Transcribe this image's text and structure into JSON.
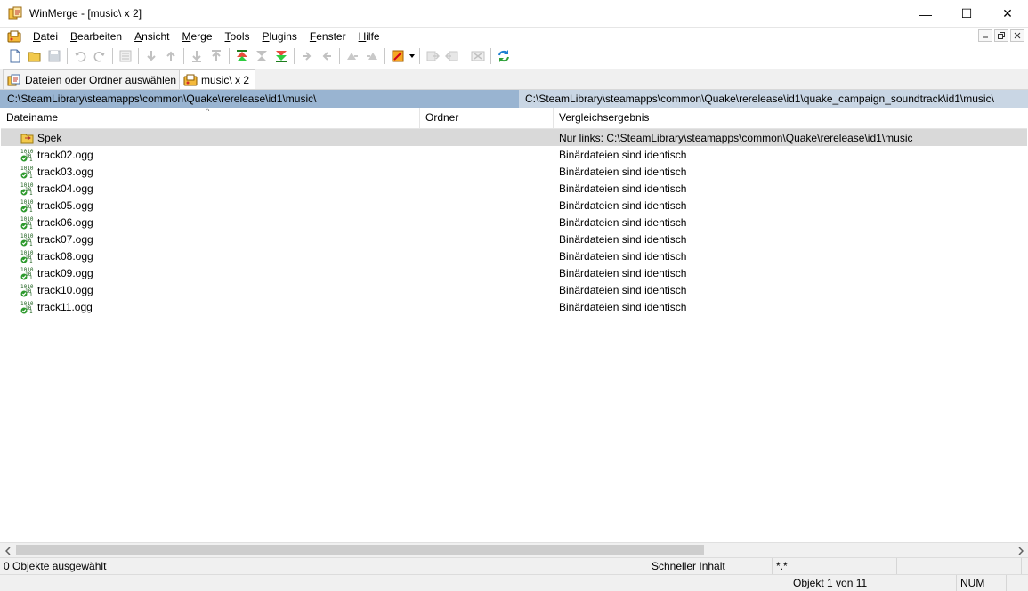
{
  "window": {
    "title": "WinMerge - [music\\ x 2]",
    "minimize": "—",
    "maximize": "☐",
    "close": "✕"
  },
  "menu": [
    {
      "pre": "",
      "u": "D",
      "post": "atei"
    },
    {
      "pre": "",
      "u": "B",
      "post": "earbeiten"
    },
    {
      "pre": "",
      "u": "A",
      "post": "nsicht"
    },
    {
      "pre": "",
      "u": "M",
      "post": "erge"
    },
    {
      "pre": "",
      "u": "T",
      "post": "ools"
    },
    {
      "pre": "",
      "u": "P",
      "post": "lugins"
    },
    {
      "pre": "",
      "u": "F",
      "post": "enster"
    },
    {
      "pre": "",
      "u": "H",
      "post": "ilfe"
    }
  ],
  "tabs": [
    {
      "label": "Dateien oder Ordner auswählen"
    },
    {
      "label": "music\\ x 2"
    }
  ],
  "paths": {
    "left": "C:\\SteamLibrary\\steamapps\\common\\Quake\\rerelease\\id1\\music\\",
    "right": "C:\\SteamLibrary\\steamapps\\common\\Quake\\rerelease\\id1\\quake_campaign_soundtrack\\id1\\music\\"
  },
  "columns": {
    "name": "Dateiname",
    "folder": "Ordner",
    "result": "Vergleichsergebnis",
    "sort_indicator": "^"
  },
  "rows": [
    {
      "name": "Spek",
      "folder": "",
      "result": "Nur links: C:\\SteamLibrary\\steamapps\\common\\Quake\\rerelease\\id1\\music",
      "kind": "folder-icon"
    },
    {
      "name": "track02.ogg",
      "folder": "",
      "result": "Binärdateien sind identisch",
      "kind": "binary-identical-icon"
    },
    {
      "name": "track03.ogg",
      "folder": "",
      "result": "Binärdateien sind identisch",
      "kind": "binary-identical-icon"
    },
    {
      "name": "track04.ogg",
      "folder": "",
      "result": "Binärdateien sind identisch",
      "kind": "binary-identical-icon"
    },
    {
      "name": "track05.ogg",
      "folder": "",
      "result": "Binärdateien sind identisch",
      "kind": "binary-identical-icon"
    },
    {
      "name": "track06.ogg",
      "folder": "",
      "result": "Binärdateien sind identisch",
      "kind": "binary-identical-icon"
    },
    {
      "name": "track07.ogg",
      "folder": "",
      "result": "Binärdateien sind identisch",
      "kind": "binary-identical-icon"
    },
    {
      "name": "track08.ogg",
      "folder": "",
      "result": "Binärdateien sind identisch",
      "kind": "binary-identical-icon"
    },
    {
      "name": "track09.ogg",
      "folder": "",
      "result": "Binärdateien sind identisch",
      "kind": "binary-identical-icon"
    },
    {
      "name": "track10.ogg",
      "folder": "",
      "result": "Binärdateien sind identisch",
      "kind": "binary-identical-icon"
    },
    {
      "name": "track11.ogg",
      "folder": "",
      "result": "Binärdateien sind identisch",
      "kind": "binary-identical-icon"
    }
  ],
  "status": {
    "selection": "0 Objekte ausgewählt",
    "compare_method": "Schneller Inhalt",
    "filter": "*.*",
    "item_position": "Objekt 1 von 11",
    "num": "NUM"
  },
  "colors": {
    "left_path_bg": "#99b4d1",
    "right_path_bg": "#c9d6e4",
    "selected_row": "#d9d9d9"
  }
}
